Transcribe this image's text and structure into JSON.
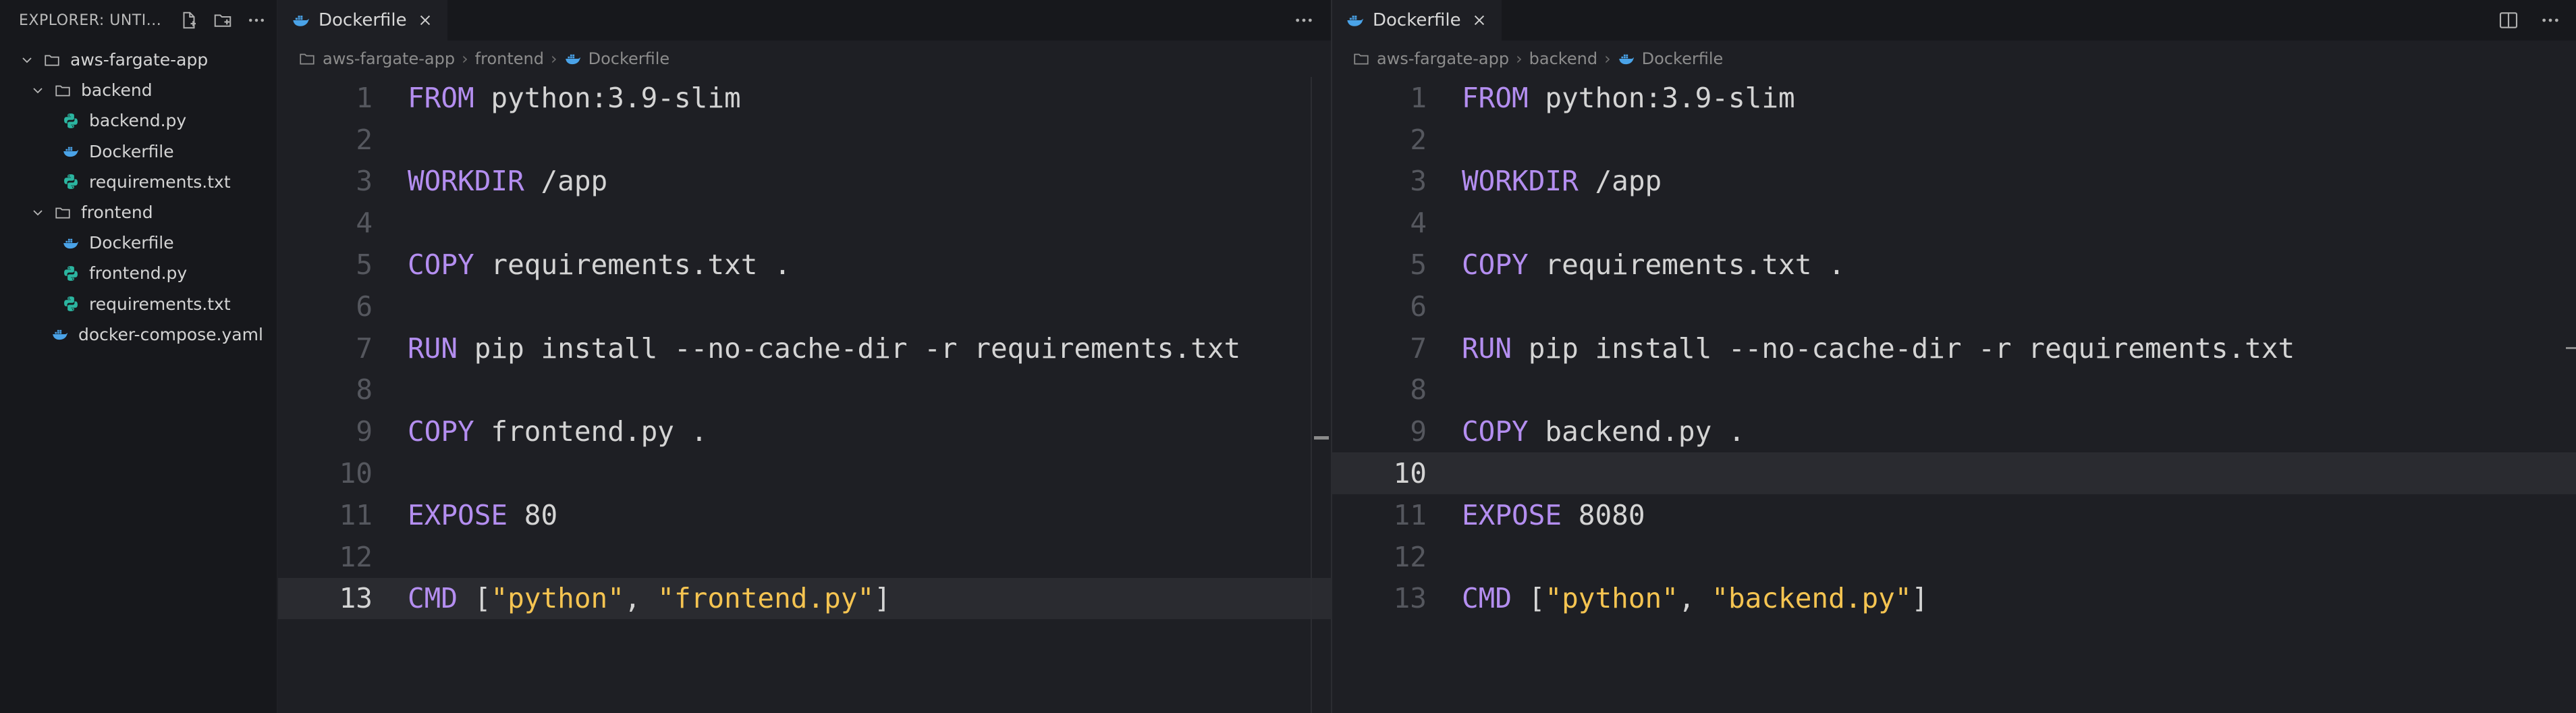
{
  "explorer": {
    "title": "EXPLORER: UNTI...",
    "actions": [
      "new-file-icon",
      "new-folder-icon",
      "more-icon"
    ],
    "tree": [
      {
        "label": "aws-fargate-app",
        "kind": "folder",
        "expanded": true,
        "depth": 0
      },
      {
        "label": "backend",
        "kind": "folder",
        "expanded": true,
        "depth": 1
      },
      {
        "label": "backend.py",
        "kind": "python",
        "depth": 2
      },
      {
        "label": "Dockerfile",
        "kind": "docker",
        "depth": 2
      },
      {
        "label": "requirements.txt",
        "kind": "text",
        "depth": 2
      },
      {
        "label": "frontend",
        "kind": "folder",
        "expanded": true,
        "depth": 1
      },
      {
        "label": "Dockerfile",
        "kind": "docker",
        "depth": 2
      },
      {
        "label": "frontend.py",
        "kind": "python",
        "depth": 2
      },
      {
        "label": "requirements.txt",
        "kind": "text",
        "depth": 2
      },
      {
        "label": "docker-compose.yaml",
        "kind": "docker",
        "depth": 1
      }
    ]
  },
  "editors": {
    "left": {
      "tab": {
        "label": "Dockerfile",
        "icon": "docker-icon",
        "close": "×"
      },
      "breadcrumb": [
        "aws-fargate-app",
        "frontend",
        "Dockerfile"
      ],
      "active_line": 13,
      "lines": [
        {
          "n": "1",
          "kw": "FROM",
          "rest": " python:3.9-slim"
        },
        {
          "n": "2"
        },
        {
          "n": "3",
          "kw": "WORKDIR",
          "rest": " /app"
        },
        {
          "n": "4"
        },
        {
          "n": "5",
          "kw": "COPY",
          "rest": " requirements.txt ."
        },
        {
          "n": "6"
        },
        {
          "n": "7",
          "kw": "RUN",
          "rest": " pip install --no-cache-dir -r requirements.txt"
        },
        {
          "n": "8"
        },
        {
          "n": "9",
          "kw": "COPY",
          "rest": " frontend.py ."
        },
        {
          "n": "10"
        },
        {
          "n": "11",
          "kw": "EXPOSE",
          "rest": " 80"
        },
        {
          "n": "12"
        },
        {
          "n": "13",
          "kw": "CMD",
          "rest": " [",
          "s1": "\"python\"",
          "mid": ", ",
          "s2": "\"frontend.py\"",
          "end": "]"
        }
      ]
    },
    "right": {
      "tab": {
        "label": "Dockerfile",
        "icon": "docker-icon",
        "close": "×"
      },
      "breadcrumb": [
        "aws-fargate-app",
        "backend",
        "Dockerfile"
      ],
      "active_line": 10,
      "lines": [
        {
          "n": "1",
          "kw": "FROM",
          "rest": " python:3.9-slim"
        },
        {
          "n": "2"
        },
        {
          "n": "3",
          "kw": "WORKDIR",
          "rest": " /app"
        },
        {
          "n": "4"
        },
        {
          "n": "5",
          "kw": "COPY",
          "rest": " requirements.txt ."
        },
        {
          "n": "6"
        },
        {
          "n": "7",
          "kw": "RUN",
          "rest": " pip install --no-cache-dir -r requirements.txt"
        },
        {
          "n": "8"
        },
        {
          "n": "9",
          "kw": "COPY",
          "rest": " backend.py ."
        },
        {
          "n": "10"
        },
        {
          "n": "11",
          "kw": "EXPOSE",
          "rest": " 8080"
        },
        {
          "n": "12"
        },
        {
          "n": "13",
          "kw": "CMD",
          "rest": " [",
          "s1": "\"python\"",
          "mid": ", ",
          "s2": "\"backend.py\"",
          "end": "]"
        }
      ]
    }
  },
  "colors": {
    "keyword": "#b48ef0",
    "string": "#f5c451",
    "text": "#d4d4d4",
    "line_number": "#55575e",
    "background": "#1e1f24",
    "sidebar": "#17181c"
  }
}
